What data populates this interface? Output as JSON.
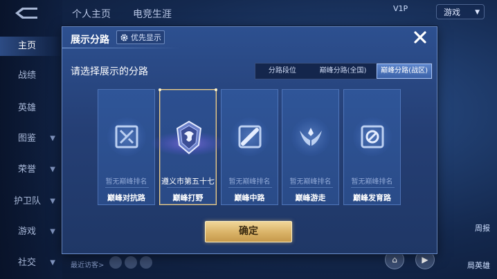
{
  "app": {
    "top_tabs": [
      "个人主页",
      "电竞生涯"
    ],
    "sidebar": [
      {
        "label": "主页",
        "active": true,
        "chevron": false
      },
      {
        "label": "战绩",
        "active": false,
        "chevron": false
      },
      {
        "label": "英雄",
        "active": false,
        "chevron": false
      },
      {
        "label": "图鉴",
        "active": false,
        "chevron": true
      },
      {
        "label": "荣誉",
        "active": false,
        "chevron": true
      },
      {
        "label": "护卫队",
        "active": false,
        "chevron": true
      },
      {
        "label": "游戏",
        "active": false,
        "chevron": true
      },
      {
        "label": "社交",
        "active": false,
        "chevron": true
      }
    ],
    "top_right_text": "游戏",
    "top_right_badge": "V1P",
    "recent_visitors": "最近访客>",
    "right_side_labels": [
      "周报",
      "局英雄"
    ]
  },
  "modal": {
    "title": "展示分路",
    "priority_label": "优先显示",
    "prompt": "请选择展示的分路",
    "tabs": [
      {
        "label": "分路段位",
        "active": false
      },
      {
        "label": "巅峰分路(全国)",
        "active": false
      },
      {
        "label": "巅峰分路(战区)",
        "active": true
      }
    ],
    "cards": [
      {
        "rank": "暂无巅峰排名",
        "lane": "巅峰对抗路",
        "icon": "clash-lane-icon",
        "selected": false
      },
      {
        "rank": "遵义市第五十七",
        "lane": "巅峰打野",
        "icon": "jungle-crest-icon",
        "selected": true
      },
      {
        "rank": "暂无巅峰排名",
        "lane": "巅峰中路",
        "icon": "mid-lane-icon",
        "selected": false
      },
      {
        "rank": "暂无巅峰排名",
        "lane": "巅峰游走",
        "icon": "roam-wings-icon",
        "selected": false
      },
      {
        "rank": "暂无巅峰排名",
        "lane": "巅峰发育路",
        "icon": "farm-lane-icon",
        "selected": false
      }
    ],
    "confirm_label": "确定",
    "colors": {
      "accent_gold": "#e8c47a",
      "panel_blue": "#2a4b88",
      "active_tab": "#4f77bd"
    }
  }
}
